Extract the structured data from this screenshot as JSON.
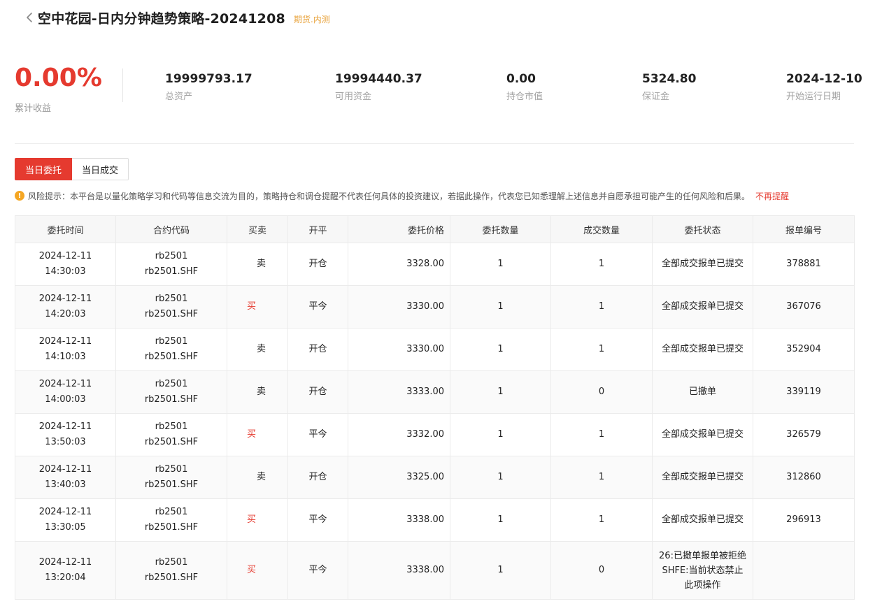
{
  "header": {
    "title": "空中花园-日内分钟趋势策略-20241208",
    "tag": "期货.内测"
  },
  "stats": {
    "main": {
      "value": "0.00%",
      "label": "累计收益"
    },
    "items": [
      {
        "value": "19999793.17",
        "label": "总资产"
      },
      {
        "value": "19994440.37",
        "label": "可用资金"
      },
      {
        "value": "0.00",
        "label": "持仓市值"
      },
      {
        "value": "5324.80",
        "label": "保证金"
      },
      {
        "value": "2024-12-10",
        "label": "开始运行日期"
      }
    ]
  },
  "tabs": [
    {
      "label": "当日委托",
      "active": true
    },
    {
      "label": "当日成交",
      "active": false
    }
  ],
  "risk": {
    "icon": "exclamation-icon",
    "text": "风险提示：本平台是以量化策略学习和代码等信息交流为目的，策略持仓和调仓提醒不代表任何具体的投资建议，若据此操作，代表您已知悉理解上述信息并自愿承担可能产生的任何风险和后果。",
    "dismiss": "不再提醒"
  },
  "colors": {
    "accent": "#e53a2f",
    "tag": "#e8a23a",
    "warn": "#f5a623"
  },
  "table": {
    "headers": [
      "委托时间",
      "合约代码",
      "买卖",
      "开平",
      "委托价格",
      "委托数量",
      "成交数量",
      "委托状态",
      "报单编号"
    ],
    "rows": [
      {
        "date": "2024-12-11",
        "time": "14:30:03",
        "code": "rb2501",
        "code_full": "rb2501.SHF",
        "side": "卖",
        "offset": "开仓",
        "price": "3328.00",
        "qty": "1",
        "filled": "1",
        "status": [
          "全部成交报单已提交"
        ],
        "order_id": "378881"
      },
      {
        "date": "2024-12-11",
        "time": "14:20:03",
        "code": "rb2501",
        "code_full": "rb2501.SHF",
        "side": "买",
        "offset": "平今",
        "price": "3330.00",
        "qty": "1",
        "filled": "1",
        "status": [
          "全部成交报单已提交"
        ],
        "order_id": "367076"
      },
      {
        "date": "2024-12-11",
        "time": "14:10:03",
        "code": "rb2501",
        "code_full": "rb2501.SHF",
        "side": "卖",
        "offset": "开仓",
        "price": "3330.00",
        "qty": "1",
        "filled": "1",
        "status": [
          "全部成交报单已提交"
        ],
        "order_id": "352904"
      },
      {
        "date": "2024-12-11",
        "time": "14:00:03",
        "code": "rb2501",
        "code_full": "rb2501.SHF",
        "side": "卖",
        "offset": "开仓",
        "price": "3333.00",
        "qty": "1",
        "filled": "0",
        "status": [
          "已撤单"
        ],
        "order_id": "339119"
      },
      {
        "date": "2024-12-11",
        "time": "13:50:03",
        "code": "rb2501",
        "code_full": "rb2501.SHF",
        "side": "买",
        "offset": "平今",
        "price": "3332.00",
        "qty": "1",
        "filled": "1",
        "status": [
          "全部成交报单已提交"
        ],
        "order_id": "326579"
      },
      {
        "date": "2024-12-11",
        "time": "13:40:03",
        "code": "rb2501",
        "code_full": "rb2501.SHF",
        "side": "卖",
        "offset": "开仓",
        "price": "3325.00",
        "qty": "1",
        "filled": "1",
        "status": [
          "全部成交报单已提交"
        ],
        "order_id": "312860"
      },
      {
        "date": "2024-12-11",
        "time": "13:30:05",
        "code": "rb2501",
        "code_full": "rb2501.SHF",
        "side": "买",
        "offset": "平今",
        "price": "3338.00",
        "qty": "1",
        "filled": "1",
        "status": [
          "全部成交报单已提交"
        ],
        "order_id": "296913"
      },
      {
        "date": "2024-12-11",
        "time": "13:20:04",
        "code": "rb2501",
        "code_full": "rb2501.SHF",
        "side": "买",
        "offset": "平今",
        "price": "3338.00",
        "qty": "1",
        "filled": "0",
        "status": [
          "26:已撤单报单被拒绝",
          "SHFE:当前状态禁止",
          "此项操作"
        ],
        "order_id": ""
      }
    ]
  }
}
